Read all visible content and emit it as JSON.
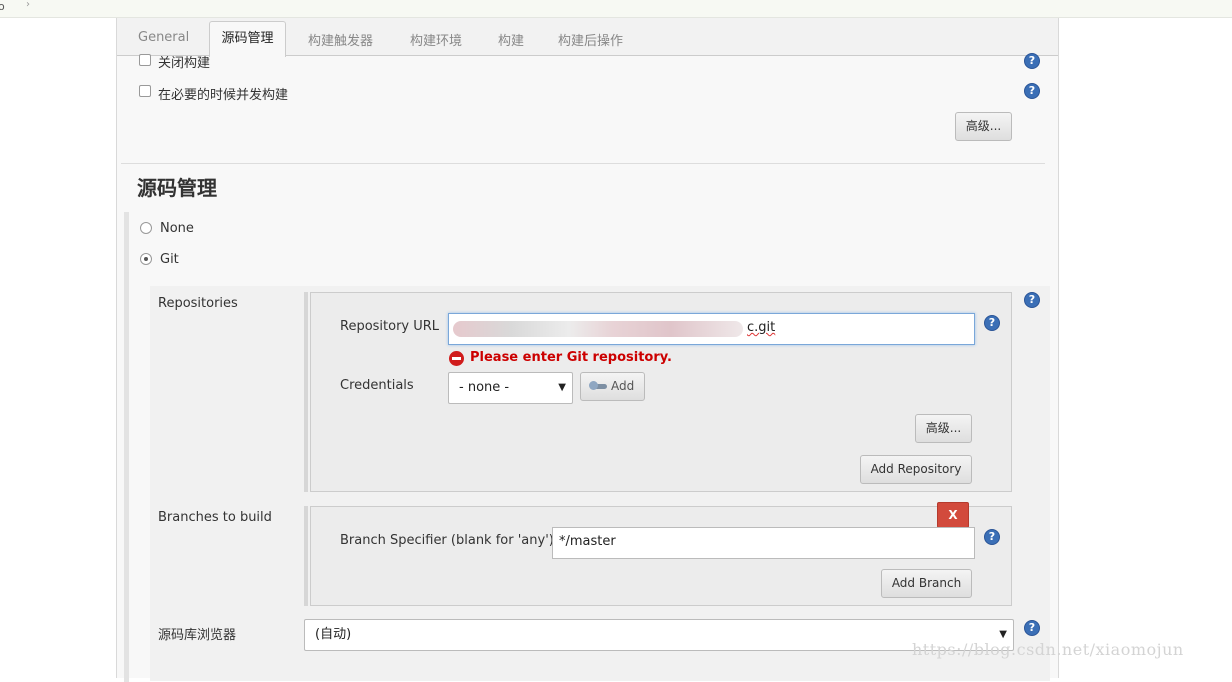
{
  "tabs": [
    "General",
    "源码管理",
    "构建触发器",
    "构建环境",
    "构建",
    "构建后操作"
  ],
  "active_tab_index": 1,
  "options": {
    "disable_build": "关闭构建",
    "concurrent_build": "在必要的时候并发构建",
    "advanced_label": "高级..."
  },
  "scm": {
    "title": "源码管理",
    "none_label": "None",
    "git_label": "Git",
    "selected": "Git",
    "repositories_label": "Repositories",
    "repository_url_label": "Repository URL",
    "repository_url_value_visible": "c.git",
    "error_message": "Please enter Git repository.",
    "credentials_label": "Credentials",
    "credentials_selected": "- none -",
    "add_label": "Add",
    "advanced_label": "高级...",
    "add_repository_label": "Add Repository",
    "branches_label": "Branches to build",
    "delete_label": "X",
    "branch_specifier_label": "Branch Specifier (blank for 'any')",
    "branch_specifier_value": "*/master",
    "add_branch_label": "Add Branch",
    "browser_label": "源码库浏览器",
    "browser_selected": "(自动)"
  },
  "help_glyph": "?",
  "watermark": "https://blog.csdn.net/xiaomojun",
  "colors": {
    "help": "#3b6fb6",
    "error": "#cc0000",
    "delete": "#d24a3c"
  }
}
